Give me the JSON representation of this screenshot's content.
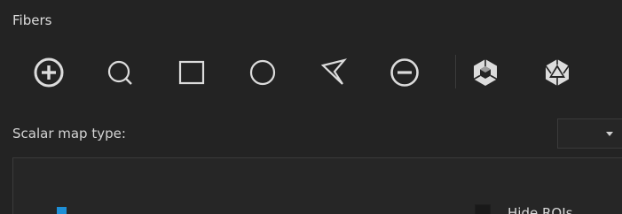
{
  "section": {
    "title": "Fibers"
  },
  "toolbar": {
    "tools": [
      {
        "name": "add-roi-icon"
      },
      {
        "name": "lasso-select-icon"
      },
      {
        "name": "rectangle-select-icon"
      },
      {
        "name": "ellipse-select-icon"
      },
      {
        "name": "polygon-select-icon"
      },
      {
        "name": "remove-roi-icon"
      },
      {
        "name": "mesh-cube-icon"
      },
      {
        "name": "mesh-icosahedron-icon"
      }
    ],
    "icon_color": "#dcdcdc"
  },
  "scalar_map": {
    "label": "Scalar map type:",
    "selected": ""
  },
  "roi": {
    "color": "#1e8fd6",
    "hide_label": "Hide ROIs",
    "hide_checked": false
  }
}
